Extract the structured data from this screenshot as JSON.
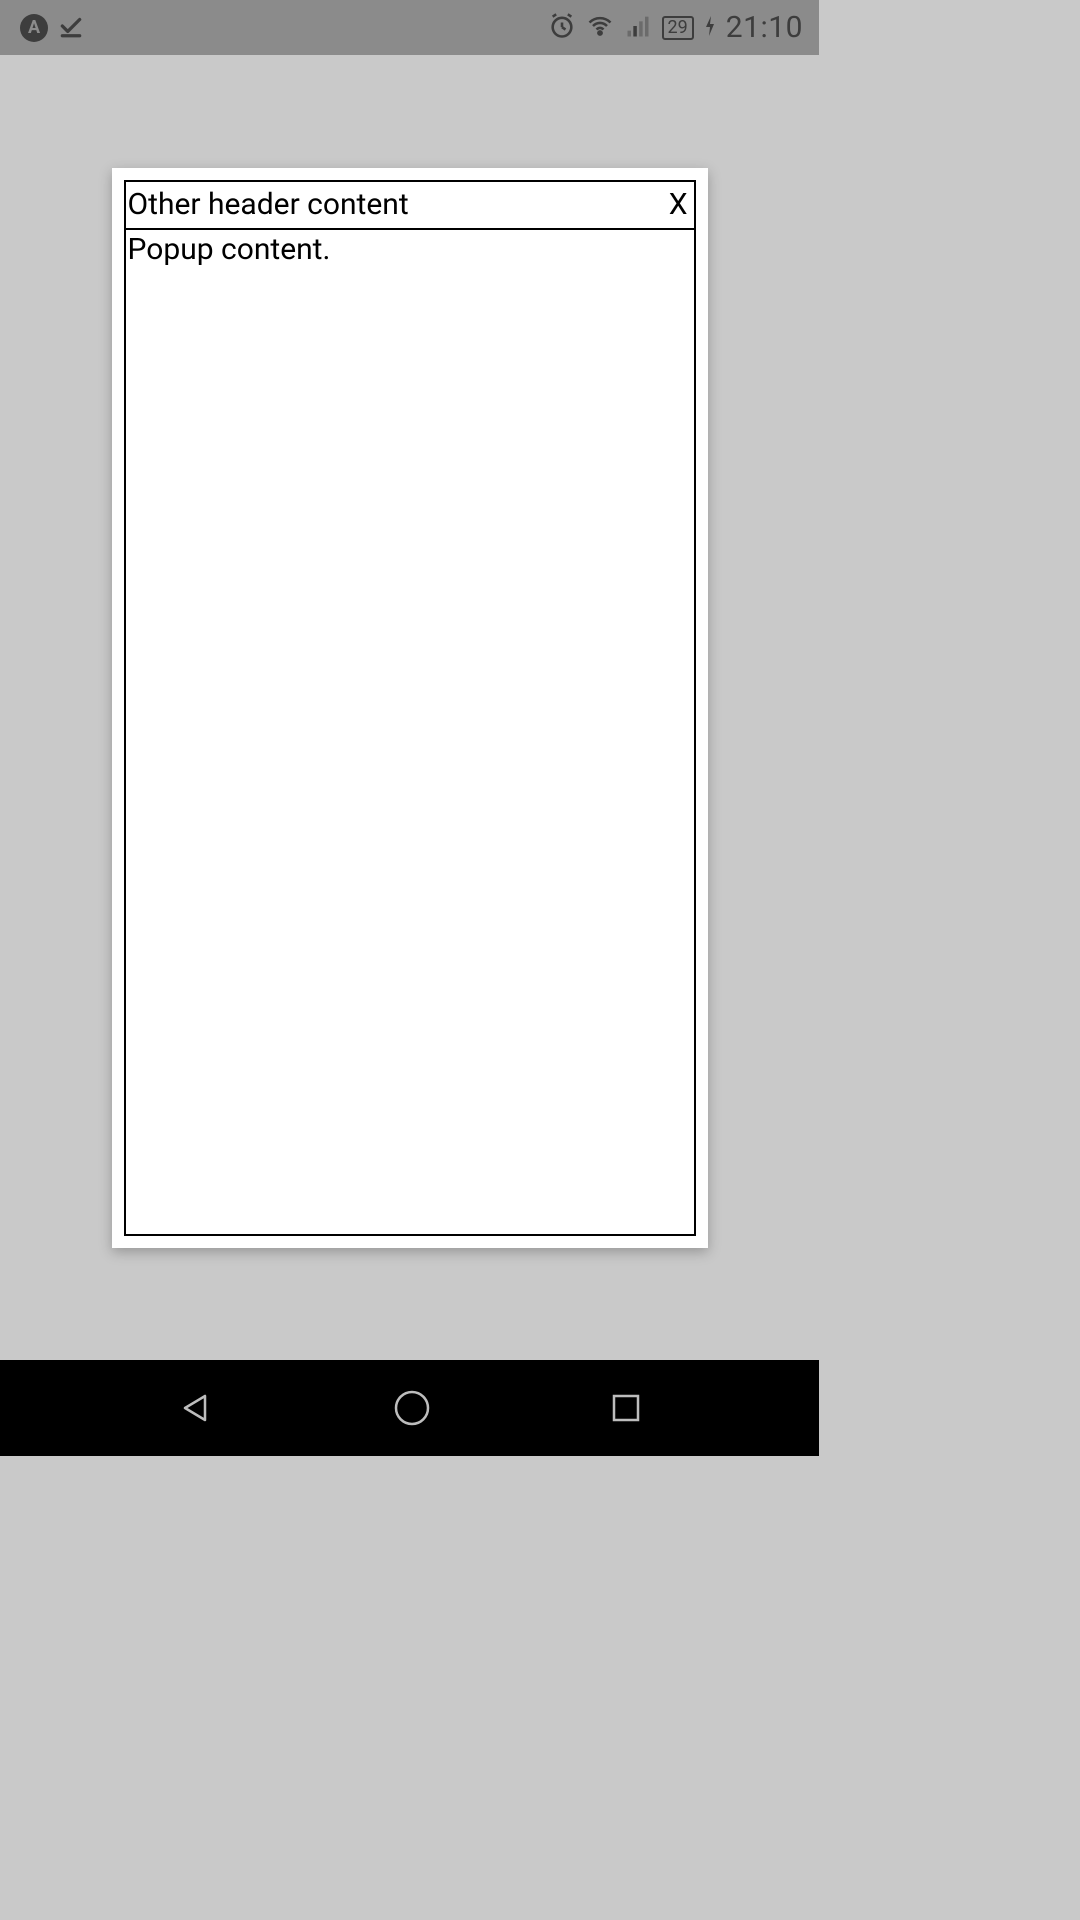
{
  "status_bar": {
    "app_icon_label": "A",
    "battery_level": "29",
    "time": "21:10"
  },
  "popup": {
    "header_title": "Other header content",
    "close_label": "X",
    "body_text": "Popup content."
  }
}
